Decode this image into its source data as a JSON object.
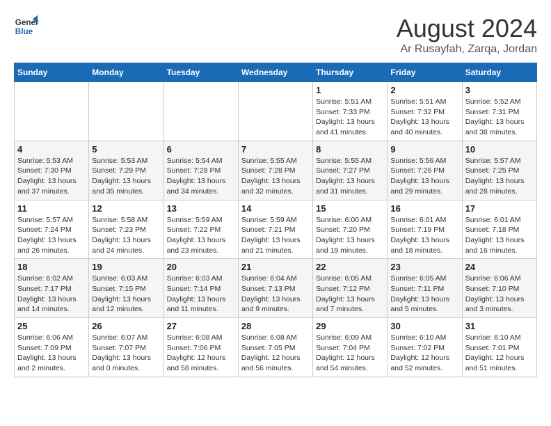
{
  "header": {
    "logo_line1": "General",
    "logo_line2": "Blue",
    "month_title": "August 2024",
    "location": "Ar Rusayfah, Zarqa, Jordan"
  },
  "days_of_week": [
    "Sunday",
    "Monday",
    "Tuesday",
    "Wednesday",
    "Thursday",
    "Friday",
    "Saturday"
  ],
  "weeks": [
    {
      "days": [
        {
          "num": "",
          "info": ""
        },
        {
          "num": "",
          "info": ""
        },
        {
          "num": "",
          "info": ""
        },
        {
          "num": "",
          "info": ""
        },
        {
          "num": "1",
          "info": "Sunrise: 5:51 AM\nSunset: 7:33 PM\nDaylight: 13 hours\nand 41 minutes."
        },
        {
          "num": "2",
          "info": "Sunrise: 5:51 AM\nSunset: 7:32 PM\nDaylight: 13 hours\nand 40 minutes."
        },
        {
          "num": "3",
          "info": "Sunrise: 5:52 AM\nSunset: 7:31 PM\nDaylight: 13 hours\nand 38 minutes."
        }
      ]
    },
    {
      "days": [
        {
          "num": "4",
          "info": "Sunrise: 5:53 AM\nSunset: 7:30 PM\nDaylight: 13 hours\nand 37 minutes."
        },
        {
          "num": "5",
          "info": "Sunrise: 5:53 AM\nSunset: 7:29 PM\nDaylight: 13 hours\nand 35 minutes."
        },
        {
          "num": "6",
          "info": "Sunrise: 5:54 AM\nSunset: 7:28 PM\nDaylight: 13 hours\nand 34 minutes."
        },
        {
          "num": "7",
          "info": "Sunrise: 5:55 AM\nSunset: 7:28 PM\nDaylight: 13 hours\nand 32 minutes."
        },
        {
          "num": "8",
          "info": "Sunrise: 5:55 AM\nSunset: 7:27 PM\nDaylight: 13 hours\nand 31 minutes."
        },
        {
          "num": "9",
          "info": "Sunrise: 5:56 AM\nSunset: 7:26 PM\nDaylight: 13 hours\nand 29 minutes."
        },
        {
          "num": "10",
          "info": "Sunrise: 5:57 AM\nSunset: 7:25 PM\nDaylight: 13 hours\nand 28 minutes."
        }
      ]
    },
    {
      "days": [
        {
          "num": "11",
          "info": "Sunrise: 5:57 AM\nSunset: 7:24 PM\nDaylight: 13 hours\nand 26 minutes."
        },
        {
          "num": "12",
          "info": "Sunrise: 5:58 AM\nSunset: 7:23 PM\nDaylight: 13 hours\nand 24 minutes."
        },
        {
          "num": "13",
          "info": "Sunrise: 5:59 AM\nSunset: 7:22 PM\nDaylight: 13 hours\nand 23 minutes."
        },
        {
          "num": "14",
          "info": "Sunrise: 5:59 AM\nSunset: 7:21 PM\nDaylight: 13 hours\nand 21 minutes."
        },
        {
          "num": "15",
          "info": "Sunrise: 6:00 AM\nSunset: 7:20 PM\nDaylight: 13 hours\nand 19 minutes."
        },
        {
          "num": "16",
          "info": "Sunrise: 6:01 AM\nSunset: 7:19 PM\nDaylight: 13 hours\nand 18 minutes."
        },
        {
          "num": "17",
          "info": "Sunrise: 6:01 AM\nSunset: 7:18 PM\nDaylight: 13 hours\nand 16 minutes."
        }
      ]
    },
    {
      "days": [
        {
          "num": "18",
          "info": "Sunrise: 6:02 AM\nSunset: 7:17 PM\nDaylight: 13 hours\nand 14 minutes."
        },
        {
          "num": "19",
          "info": "Sunrise: 6:03 AM\nSunset: 7:15 PM\nDaylight: 13 hours\nand 12 minutes."
        },
        {
          "num": "20",
          "info": "Sunrise: 6:03 AM\nSunset: 7:14 PM\nDaylight: 13 hours\nand 11 minutes."
        },
        {
          "num": "21",
          "info": "Sunrise: 6:04 AM\nSunset: 7:13 PM\nDaylight: 13 hours\nand 9 minutes."
        },
        {
          "num": "22",
          "info": "Sunrise: 6:05 AM\nSunset: 7:12 PM\nDaylight: 13 hours\nand 7 minutes."
        },
        {
          "num": "23",
          "info": "Sunrise: 6:05 AM\nSunset: 7:11 PM\nDaylight: 13 hours\nand 5 minutes."
        },
        {
          "num": "24",
          "info": "Sunrise: 6:06 AM\nSunset: 7:10 PM\nDaylight: 13 hours\nand 3 minutes."
        }
      ]
    },
    {
      "days": [
        {
          "num": "25",
          "info": "Sunrise: 6:06 AM\nSunset: 7:09 PM\nDaylight: 13 hours\nand 2 minutes."
        },
        {
          "num": "26",
          "info": "Sunrise: 6:07 AM\nSunset: 7:07 PM\nDaylight: 13 hours\nand 0 minutes."
        },
        {
          "num": "27",
          "info": "Sunrise: 6:08 AM\nSunset: 7:06 PM\nDaylight: 12 hours\nand 58 minutes."
        },
        {
          "num": "28",
          "info": "Sunrise: 6:08 AM\nSunset: 7:05 PM\nDaylight: 12 hours\nand 56 minutes."
        },
        {
          "num": "29",
          "info": "Sunrise: 6:09 AM\nSunset: 7:04 PM\nDaylight: 12 hours\nand 54 minutes."
        },
        {
          "num": "30",
          "info": "Sunrise: 6:10 AM\nSunset: 7:02 PM\nDaylight: 12 hours\nand 52 minutes."
        },
        {
          "num": "31",
          "info": "Sunrise: 6:10 AM\nSunset: 7:01 PM\nDaylight: 12 hours\nand 51 minutes."
        }
      ]
    }
  ]
}
